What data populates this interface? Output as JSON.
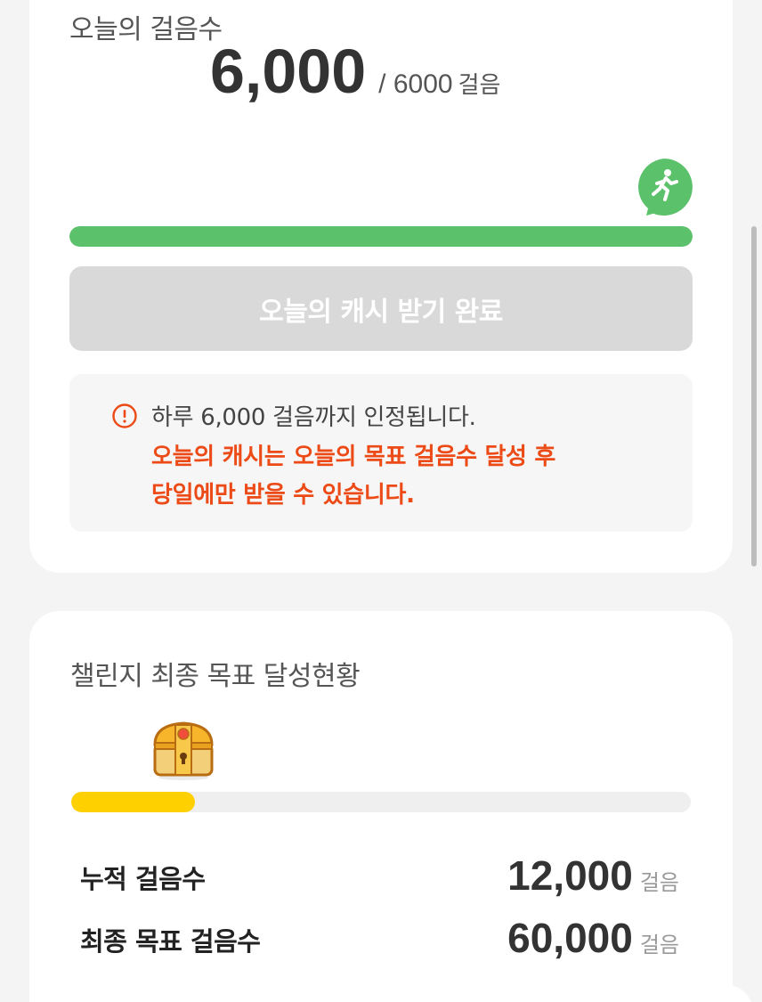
{
  "today": {
    "title": "오늘의 걸음수",
    "steps": "6,000",
    "goal": "/ 6000",
    "goal_unit": "걸음",
    "progress": 1.0,
    "runner_icon": "running-person-icon",
    "button_label": "오늘의 캐시 받기 완료",
    "notice": {
      "icon": "warning-circle-icon",
      "line1": "하루 6,000 걸음까지 인정됩니다.",
      "red_line1": "오늘의 캐시는 오늘의 목표 걸음수 달성 후",
      "red_line2": "당일에만 받을 수 있습니다."
    }
  },
  "challenge": {
    "title": "챌린지 최종 목표 달성현황",
    "chest_icon": "treasure-chest-icon",
    "progress": 0.2,
    "stats": [
      {
        "label": "누적 걸음수",
        "value": "12,000",
        "unit": "걸음"
      },
      {
        "label": "최종 목표 걸음수",
        "value": "60,000",
        "unit": "걸음"
      }
    ]
  },
  "colors": {
    "green": "#5cc16b",
    "yellow": "#ffd000",
    "red": "#ec4a16",
    "button_disabled": "#d9d9d9"
  }
}
